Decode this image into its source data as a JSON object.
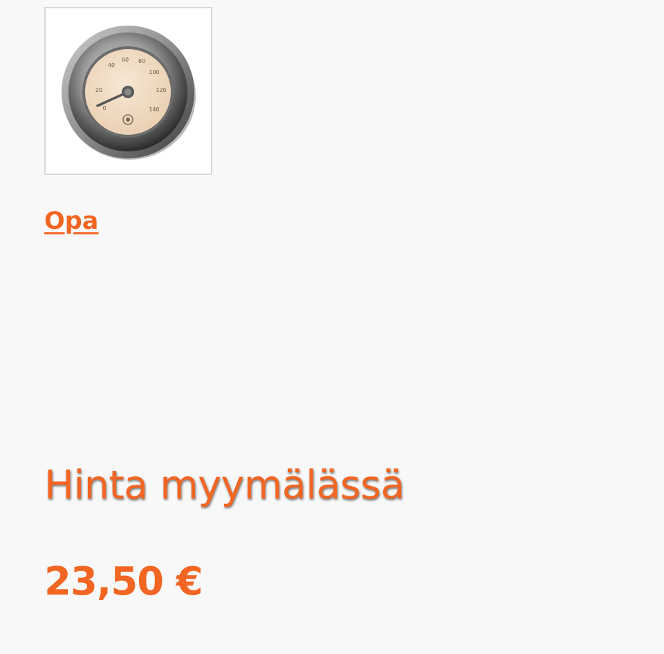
{
  "product": {
    "image": {
      "icon": "sauna-thermometer-icon",
      "dial_labels": [
        "40",
        "60",
        "80",
        "100",
        "120",
        "140",
        "20",
        "0"
      ]
    },
    "brand": "Opa",
    "price_label": "Hinta myymälässä",
    "price": "23,50 €"
  },
  "colors": {
    "accent": "#f26522",
    "background": "#f8f8f8",
    "thumb_border": "#d9d9d9"
  }
}
